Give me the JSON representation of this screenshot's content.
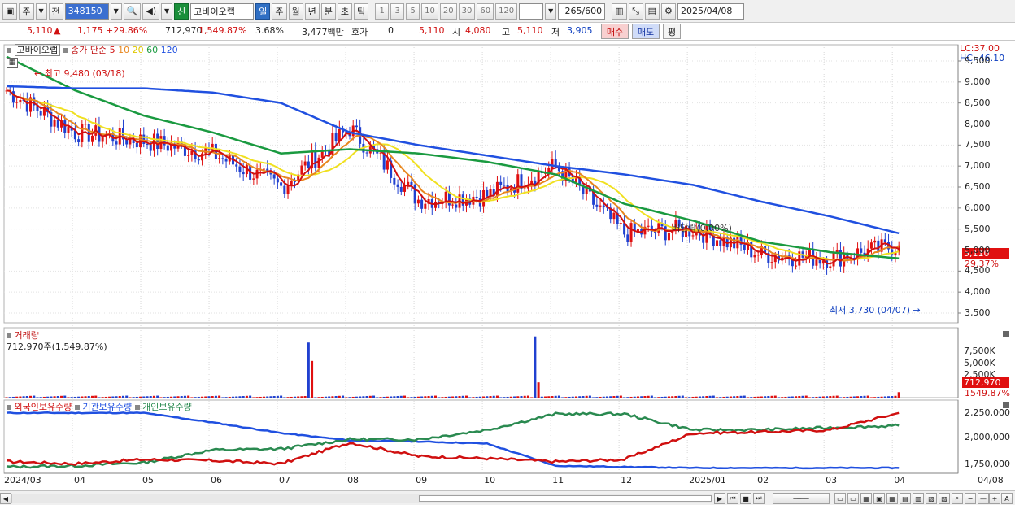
{
  "toolbar": {
    "period_type": "주",
    "prev_label": "전",
    "stock_code": "348150",
    "credit_badge": "신",
    "stock_name": "고바이오랩",
    "interval_tabs": [
      "일",
      "주",
      "월",
      "년",
      "분",
      "초",
      "틱"
    ],
    "active_interval": "일",
    "numbers": [
      "1",
      "3",
      "5",
      "10",
      "20",
      "30",
      "60",
      "120"
    ],
    "count_display": "265",
    "count_max": "/600",
    "date": "2025/04/08"
  },
  "quote": {
    "price": "5,110",
    "change": "1,175",
    "change_pct": "+29.86%",
    "volume": "712,970",
    "volume_pct": "1,549.87%",
    "turnover_pct": "3.68%",
    "amount": "3,477백만",
    "hoga_label": "호가",
    "hoga_value": "0",
    "bid_price": "5,110",
    "open_label": "시",
    "open_value": "4,080",
    "high_label": "고",
    "high_value": "5,110",
    "low_label": "저",
    "low_value": "3,905",
    "buy_label": "매수",
    "sell_label": "매도",
    "avg_label": "평"
  },
  "price_panel": {
    "title": "고바이오랩",
    "ma_label": "종가 단순",
    "ma_periods": [
      "5",
      "10",
      "20",
      "60",
      "120"
    ],
    "ma_colors": [
      "#d01010",
      "#e8871e",
      "#f0e020",
      "#1a9a40",
      "#2050e0"
    ],
    "lc": "LC:37.00",
    "hc": "HC:-46.10",
    "high_annotation": "최고 9,480 (03/18)",
    "low_annotation": "최저 3,730 (04/07)",
    "dividend_annotation": "배당락(0.00%)",
    "price_tag": "5,110",
    "pct_tag": "29.37%",
    "y_ticks": [
      "9,500",
      "9,000",
      "8,500",
      "8,000",
      "7,500",
      "7,000",
      "6,500",
      "6,000",
      "5,500",
      "5,000",
      "4,500",
      "4,000",
      "3,500"
    ]
  },
  "volume_panel": {
    "title": "거래량",
    "value_label": "712,970주(1,549.87%)",
    "tag_value": "712,970",
    "tag_pct": "1549.87%",
    "y_ticks": [
      "7,500K",
      "5,000K",
      "2,500K"
    ]
  },
  "holdings_panel": {
    "legend": [
      "외국인보유수량",
      "기관보유수량",
      "개인보유수량"
    ],
    "legend_colors": [
      "#d01010",
      "#2050e0",
      "#2a8a50"
    ],
    "y_ticks": [
      "2,250,000",
      "2,000,000",
      "1,750,000"
    ]
  },
  "x_axis": {
    "labels": [
      "2024/03",
      "04",
      "05",
      "06",
      "07",
      "08",
      "09",
      "10",
      "11",
      "12",
      "2025/01",
      "02",
      "03",
      "04",
      "04/08"
    ]
  },
  "chart_data": {
    "type": "line",
    "title": "",
    "x_labels": [
      "2024/03",
      "04",
      "05",
      "06",
      "07",
      "08",
      "09",
      "10",
      "11",
      "12",
      "2025/01",
      "02",
      "03",
      "04"
    ],
    "price_close_monthly": [
      8800,
      7800,
      7600,
      7300,
      6500,
      7900,
      6200,
      6300,
      7000,
      5400,
      5500,
      4900,
      4800,
      5110
    ],
    "ma120": [
      8900,
      8850,
      8850,
      8750,
      8500,
      7800,
      7500,
      7250,
      7000,
      6800,
      6550,
      6150,
      5800,
      5400
    ],
    "ma60": [
      9600,
      8800,
      8200,
      7800,
      7300,
      7400,
      7300,
      7100,
      6800,
      6100,
      5700,
      5200,
      4950,
      4800
    ],
    "ylim": [
      3500,
      9500
    ],
    "volume_peaks_k": [
      {
        "month": "07",
        "value": 7200
      },
      {
        "month": "10",
        "value": 8000
      },
      {
        "month": "04",
        "value": 712.97
      }
    ],
    "holdings": {
      "ylim": [
        1700000,
        2300000
      ],
      "foreign": [
        1780000,
        1760000,
        1800000,
        1790000,
        1760000,
        1960000,
        1830000,
        1810000,
        1780000,
        1800000,
        2050000,
        2060000,
        2080000,
        2240000
      ],
      "institution": [
        2240000,
        2240000,
        2240000,
        2150000,
        2050000,
        1980000,
        1970000,
        1950000,
        1740000,
        1730000,
        1720000,
        1720000,
        1720000,
        1720000
      ],
      "individual": [
        1730000,
        1740000,
        1770000,
        1890000,
        1900000,
        1990000,
        1990000,
        2080000,
        2230000,
        2230000,
        2080000,
        2080000,
        2100000,
        2120000
      ]
    }
  }
}
